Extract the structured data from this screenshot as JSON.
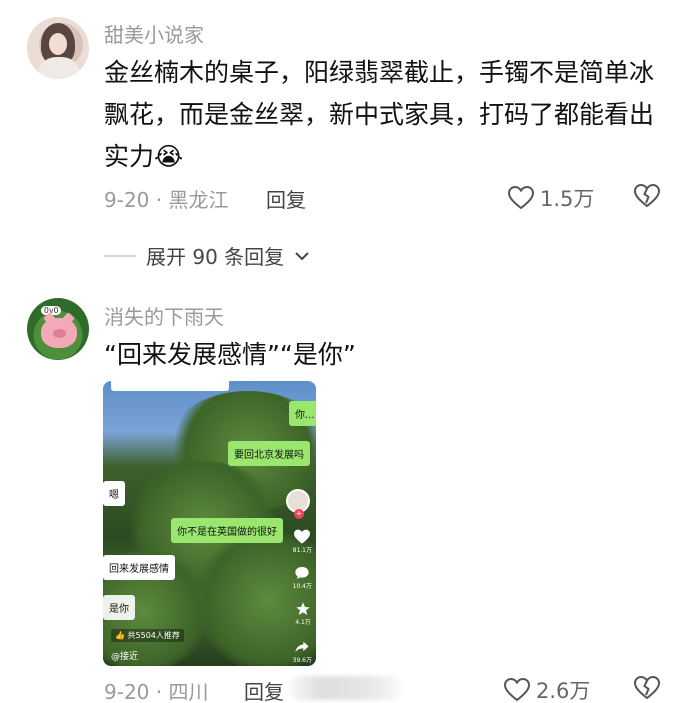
{
  "comments": [
    {
      "username": "甜美小说家",
      "text_line1": "金丝楠木的桌子，阳绿翡翠截止，手镯不是简单冰",
      "text_line2": "飘花，而是金丝翠，新中式家具，打码了都能看出",
      "text_line3": "实力",
      "emoji": "😭",
      "meta": "9-20 · 黑龙江",
      "reply_label": "回复",
      "likes": "1.5万"
    },
    {
      "username": "消失的下雨天",
      "text": "“回来发展感情”“是你”",
      "meta": "9-20 · 四川",
      "reply_label": "回复",
      "likes": "2.6万",
      "avatar_badge": "OvO"
    }
  ],
  "expand_replies": "展开 90 条回复",
  "screenshot": {
    "messages": {
      "m1": "你...",
      "m2": "要回北京发展吗",
      "m3": "嗯",
      "m4": "你不是在英国做的很好",
      "m5": "回来发展感情",
      "m6": "是你"
    },
    "side": {
      "likes": "81.1万",
      "comments": "10.4万",
      "stars": "4.1万",
      "shares": "39.6万"
    },
    "recommend": "共5504人推荐",
    "location": "@接近"
  }
}
